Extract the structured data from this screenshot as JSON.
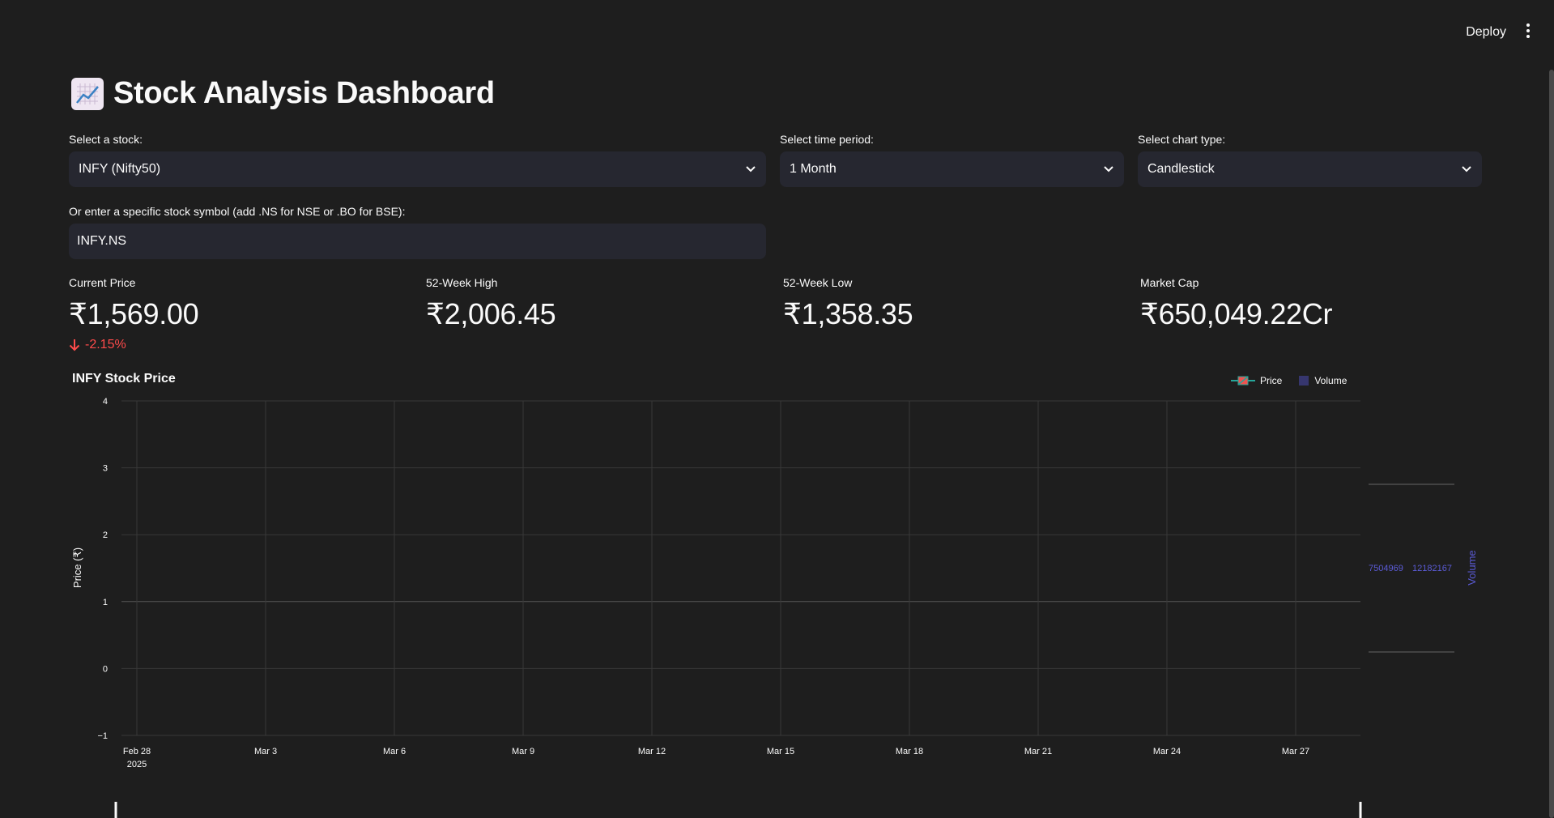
{
  "header": {
    "deploy_label": "Deploy",
    "menu_icon": "kebab-menu-icon"
  },
  "title": {
    "icon": "chart-increasing-icon",
    "text": "Stock Analysis Dashboard"
  },
  "controls": {
    "stock": {
      "label": "Select a stock:",
      "value": "INFY (Nifty50)"
    },
    "period": {
      "label": "Select time period:",
      "value": "1 Month"
    },
    "chart_type": {
      "label": "Select chart type:",
      "value": "Candlestick"
    },
    "symbol": {
      "label": "Or enter a specific stock symbol (add .NS for NSE or .BO for BSE):",
      "value": "INFY.NS"
    }
  },
  "metrics": {
    "current_price": {
      "label": "Current Price",
      "value": "₹1,569.00",
      "delta": "-2.15%"
    },
    "high_52w": {
      "label": "52-Week High",
      "value": "₹2,006.45"
    },
    "low_52w": {
      "label": "52-Week Low",
      "value": "₹1,358.35"
    },
    "market_cap": {
      "label": "Market Cap",
      "value": "₹650,049.22Cr"
    }
  },
  "colors": {
    "background": "#1e1e1e",
    "input_bg": "#262730",
    "delta_negative": "#ff4b4b",
    "volume_color": "#5b5bd6",
    "increasing": "#26a69a",
    "decreasing": "#ef5350"
  },
  "chart_data": {
    "type": "line",
    "title": "INFY Stock Price",
    "legend": [
      "Price",
      "Volume"
    ],
    "legend_placement": "top-right",
    "ylabel": "Price (₹)",
    "y2label": "Volume",
    "yticks": [
      "4",
      "3",
      "2",
      "1",
      "0",
      "−1"
    ],
    "ylim": [
      -1,
      4
    ],
    "xticks": [
      "Feb 28",
      "Mar 3",
      "Mar 6",
      "Mar 9",
      "Mar 12",
      "Mar 15",
      "Mar 18",
      "Mar 21",
      "Mar 24",
      "Mar 27"
    ],
    "xtick_year": "2025",
    "volume_ticks": [
      "7504969",
      "12182167"
    ],
    "grid": true,
    "series": []
  }
}
